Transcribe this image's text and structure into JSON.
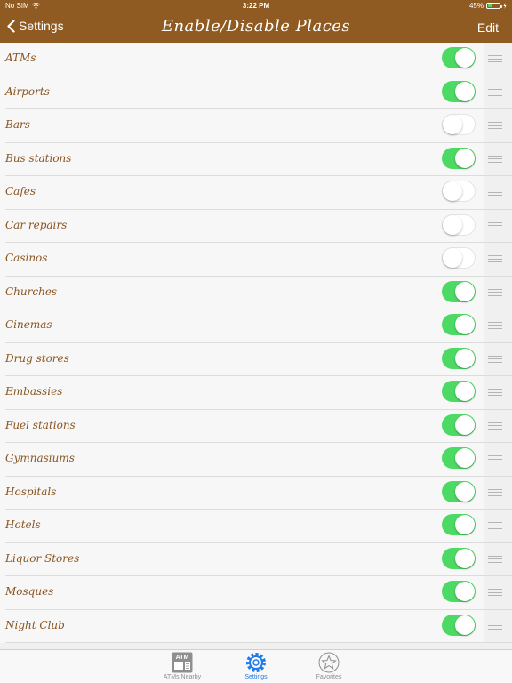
{
  "status_bar": {
    "carrier": "No SIM",
    "time": "3:22 PM",
    "battery": "45%",
    "battery_level": 0.45
  },
  "nav": {
    "back_label": "Settings",
    "title": "Enable/Disable Places",
    "edit_label": "Edit"
  },
  "places": [
    {
      "label": "ATMs",
      "enabled": true
    },
    {
      "label": "Airports",
      "enabled": true
    },
    {
      "label": "Bars",
      "enabled": false
    },
    {
      "label": "Bus stations",
      "enabled": true
    },
    {
      "label": "Cafes",
      "enabled": false
    },
    {
      "label": "Car repairs",
      "enabled": false
    },
    {
      "label": "Casinos",
      "enabled": false
    },
    {
      "label": "Churches",
      "enabled": true
    },
    {
      "label": "Cinemas",
      "enabled": true
    },
    {
      "label": "Drug stores",
      "enabled": true
    },
    {
      "label": "Embassies",
      "enabled": true
    },
    {
      "label": "Fuel stations",
      "enabled": true
    },
    {
      "label": "Gymnasiums",
      "enabled": true
    },
    {
      "label": "Hospitals",
      "enabled": true
    },
    {
      "label": "Hotels",
      "enabled": true
    },
    {
      "label": "Liquor Stores",
      "enabled": true
    },
    {
      "label": "Mosques",
      "enabled": true
    },
    {
      "label": "Night Club",
      "enabled": true
    }
  ],
  "tab_bar": {
    "tabs": [
      {
        "label": "ATMs Nearby",
        "icon": "atm-icon",
        "active": false
      },
      {
        "label": "Settings",
        "icon": "gear-icon",
        "active": true
      },
      {
        "label": "Favorites",
        "icon": "star-icon",
        "active": false
      }
    ]
  },
  "colors": {
    "brand": "#8f5b22",
    "label": "#8a5520",
    "toggle_on": "#4cd964",
    "tab_active": "#1e7be8",
    "tab_inactive": "#8e8e8e"
  }
}
